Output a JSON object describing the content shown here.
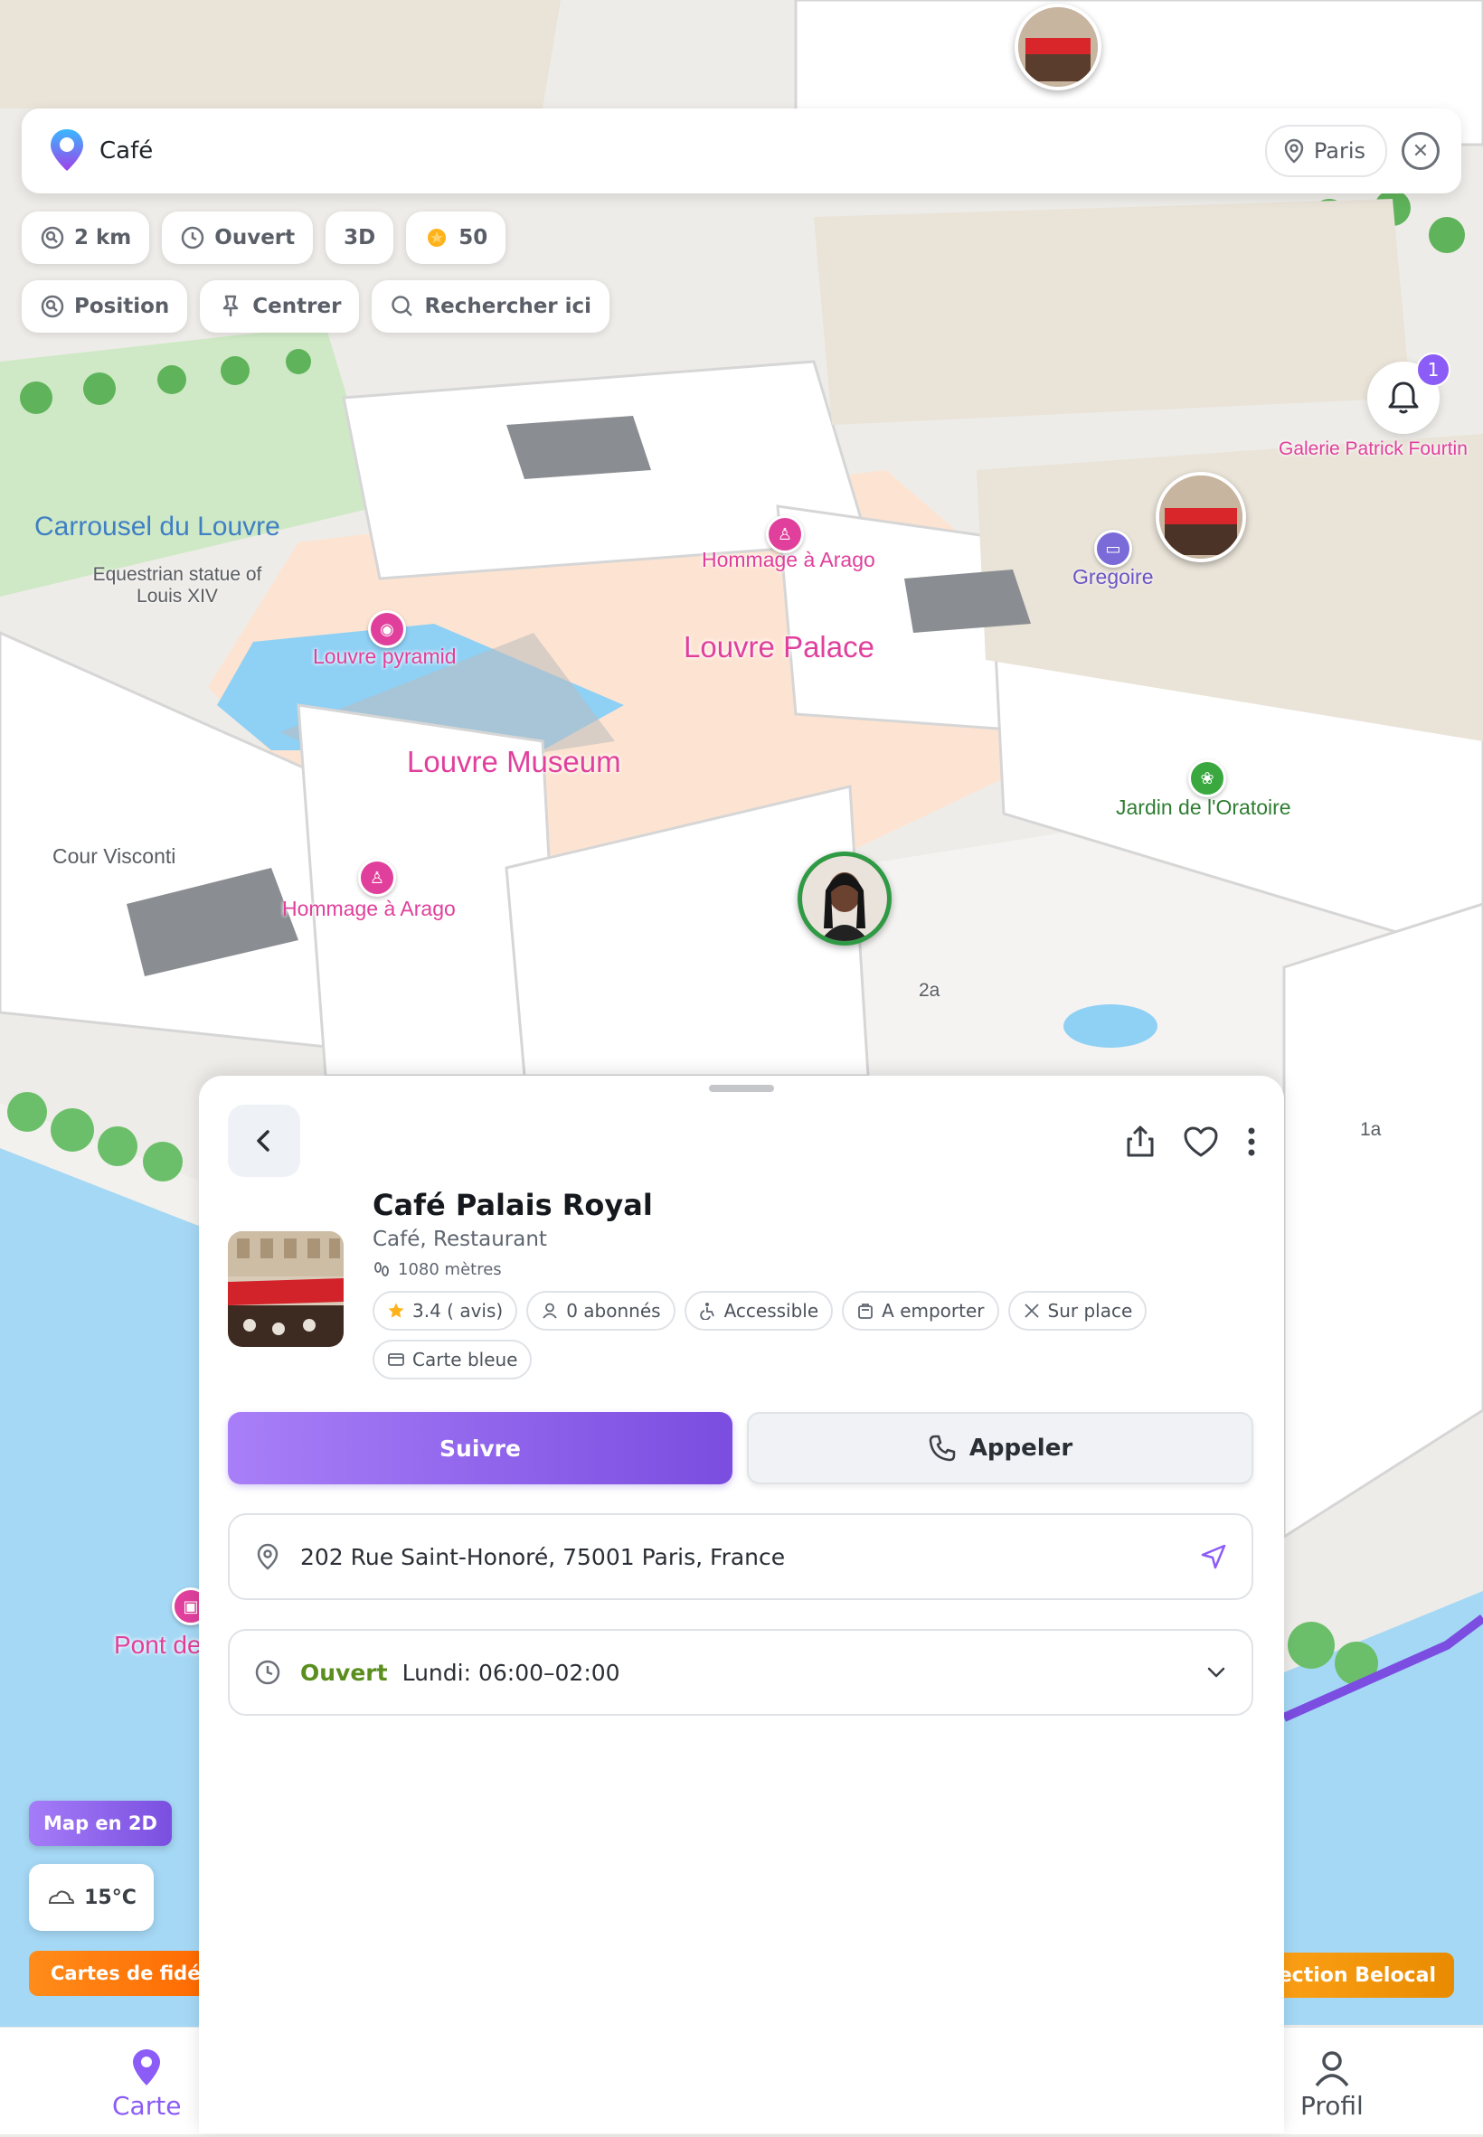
{
  "search": {
    "query": "Café",
    "city": "Paris"
  },
  "filters": {
    "row1": [
      {
        "label": "2 km",
        "icon": "radius-icon"
      },
      {
        "label": "Ouvert",
        "icon": "clock-icon"
      },
      {
        "label": "3D",
        "icon": ""
      },
      {
        "label": "50",
        "icon": "coin-icon"
      }
    ],
    "row2": [
      {
        "label": "Position",
        "icon": "location-target-icon"
      },
      {
        "label": "Centrer",
        "icon": "pin-icon"
      },
      {
        "label": "Rechercher ici",
        "icon": "search-icon"
      }
    ]
  },
  "notifications": {
    "count": "1"
  },
  "map_labels": {
    "carrousel": "Carrousel du Louvre",
    "equestrian": "Equestrian statue of Louis XIV",
    "louvre_pyramid": "Louvre pyramid",
    "louvre_museum": "Louvre Museum",
    "louvre_palace": "Louvre Palace",
    "hommage1": "Hommage à Arago",
    "hommage2": "Hommage à Arago",
    "cour_visconti": "Cour Visconti",
    "gregoire": "Gregoire",
    "galerie": "Galerie Patrick Fourtin",
    "jardin": "Jardin de l'Oratoire",
    "pont": "Pont de",
    "num_2a": "2a",
    "num_1a": "1a"
  },
  "floating": {
    "map_mode": "Map en 2D",
    "temperature": "15°C",
    "loyalty": "Cartes de fidélité",
    "selection": "Sélection Belocal"
  },
  "place": {
    "name": "Café Palais Royal",
    "category": "Café, Restaurant",
    "distance": "1080 mètres",
    "tags": [
      {
        "label": "3.4 ( avis)",
        "icon": "star-icon"
      },
      {
        "label": "0 abonnés",
        "icon": "user-icon"
      },
      {
        "label": "Accessible",
        "icon": "wheelchair-icon"
      },
      {
        "label": "A emporter",
        "icon": "bag-icon"
      },
      {
        "label": "Sur place",
        "icon": "cutlery-icon"
      },
      {
        "label": "Carte bleue",
        "icon": "card-icon"
      }
    ],
    "follow_label": "Suivre",
    "call_label": "Appeler",
    "address": "202 Rue Saint-Honoré, 75001 Paris, France",
    "status": "Ouvert",
    "hours": "Lundi: 06:00–02:00"
  },
  "nav": {
    "map": "Carte",
    "profile": "Profil"
  },
  "colors": {
    "accent": "#8b5cf6",
    "open": "#5a8f1f",
    "poi": "#e0409c",
    "water": "#a5d8f5"
  }
}
